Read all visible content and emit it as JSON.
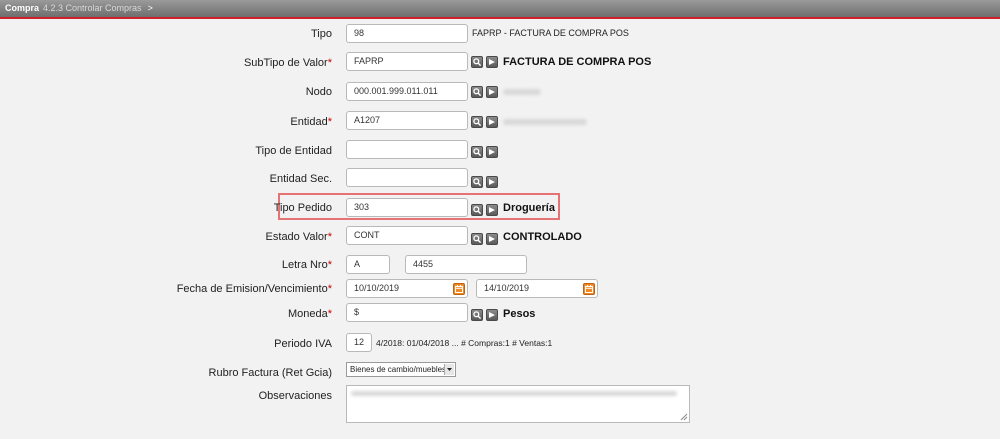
{
  "breadcrumb": {
    "root": "Compra",
    "current": "4.2.3 Controlar Compras",
    "separator": ">"
  },
  "form": {
    "tipo": {
      "label": "Tipo",
      "value": "98",
      "desc": "FAPRP - FACTURA DE COMPRA POS"
    },
    "subtipo": {
      "label": "SubTipo de Valor",
      "value": "FAPRP",
      "desc": "FACTURA DE COMPRA POS"
    },
    "nodo": {
      "label": "Nodo",
      "value": "000.001.999.011.011"
    },
    "entidad": {
      "label": "Entidad",
      "value": "A1207"
    },
    "tipo_entidad": {
      "label": "Tipo de Entidad",
      "value": ""
    },
    "entidad_sec": {
      "label": "Entidad Sec.",
      "value": ""
    },
    "tipo_pedido": {
      "label": "Tipo Pedido",
      "value": "303",
      "desc": "Droguería"
    },
    "estado_valor": {
      "label": "Estado Valor",
      "value": "CONT",
      "desc": "CONTROLADO"
    },
    "letra_nro": {
      "label": "Letra Nro",
      "letra": "A",
      "nro": "4455"
    },
    "fechas": {
      "label": "Fecha de Emision/Vencimiento",
      "emision": "10/10/2019",
      "vencimiento": "14/10/2019"
    },
    "moneda": {
      "label": "Moneda",
      "value": "$",
      "desc": "Pesos"
    },
    "periodo_iva": {
      "label": "Periodo IVA",
      "value": "12",
      "desc": "4/2018: 01/04/2018 ... # Compras:1 # Ventas:1"
    },
    "rubro": {
      "label": "Rubro Factura (Ret Gcia)",
      "selected": "Bienes de cambio/muebles"
    },
    "observaciones": {
      "label": "Observaciones"
    }
  },
  "icons": {
    "search": "search-icon",
    "lookup": "arrow-lookup-icon",
    "calendar": "calendar-icon"
  },
  "colors": {
    "accent": "#d0202a",
    "required": "#cc0000",
    "calendar": "#f08a24"
  }
}
